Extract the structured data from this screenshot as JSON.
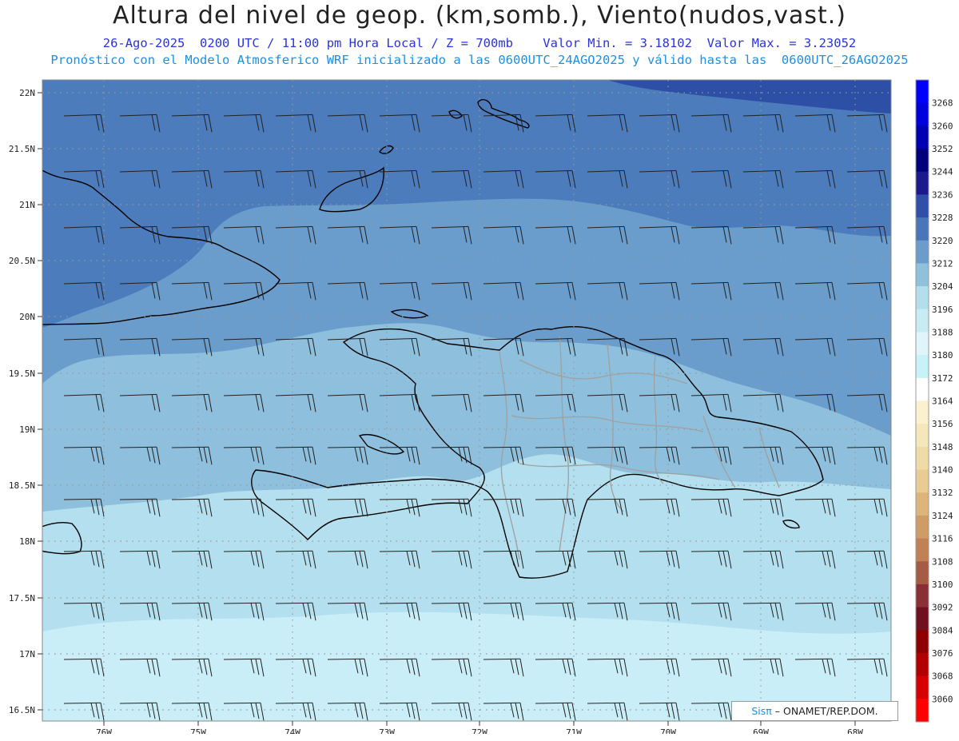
{
  "header": {
    "title": "Altura del nivel de geop. (km,somb.), Viento(nudos,vast.)",
    "line1": "26-Ago-2025  0200 UTC / 11:00 pm Hora Local / Z = 700mb    Valor Min. = 3.18102  Valor Max. = 3.23052",
    "line2": "Pronóstico con el Modelo Atmosferico WRF inicializado a las 0600UTC_24AGO2025 y válido hasta las  0600UTC_26AGO2025"
  },
  "axes": {
    "lat_labels": [
      "22N",
      "21.5N",
      "21N",
      "20.5N",
      "20N",
      "19.5N",
      "19N",
      "18.5N",
      "18N",
      "17.5N",
      "17N",
      "16.5N"
    ],
    "lon_labels": [
      "76W",
      "75W",
      "74W",
      "73W",
      "72W",
      "71W",
      "70W",
      "69W",
      "68W"
    ]
  },
  "colorbar": {
    "levels": [
      "3268",
      "3260",
      "3252",
      "3244",
      "3236",
      "3228",
      "3220",
      "3212",
      "3204",
      "3196",
      "3188",
      "3180",
      "3172",
      "3164",
      "3156",
      "3148",
      "3140",
      "3132",
      "3124",
      "3116",
      "3108",
      "3100",
      "3092",
      "3084",
      "3076",
      "3068",
      "3060"
    ],
    "colors": [
      "#0000ff",
      "#0000dd",
      "#0000b0",
      "#00007a",
      "#1a1a8c",
      "#2f4fa8",
      "#4876b8",
      "#6b9ccc",
      "#8fc0dc",
      "#b3dfec",
      "#c8ecf4",
      "#dff5fa",
      "#c6f2f8",
      "#ffffff",
      "#fbf1cc",
      "#f6e7bb",
      "#efdba6",
      "#e8cc92",
      "#ddb57b",
      "#cf9c66",
      "#c08254",
      "#a65c44",
      "#8a2f35",
      "#70101f",
      "#8e0000",
      "#b20000",
      "#d60000",
      "#ff0000"
    ]
  },
  "credit": {
    "brand": "Sisπ",
    "text": "ONAMET/REP.DOM."
  },
  "map_colors": {
    "band_3228": "#2d50a6",
    "band_3220": "#4c7cbc",
    "band_3212": "#6a9ccc",
    "band_3204": "#8ebfdc",
    "band_3196": "#b4dfee",
    "band_3188": "#c9eef7",
    "coast": "#000000",
    "provinces": "#a0a0a0",
    "barbs": "#222222"
  }
}
